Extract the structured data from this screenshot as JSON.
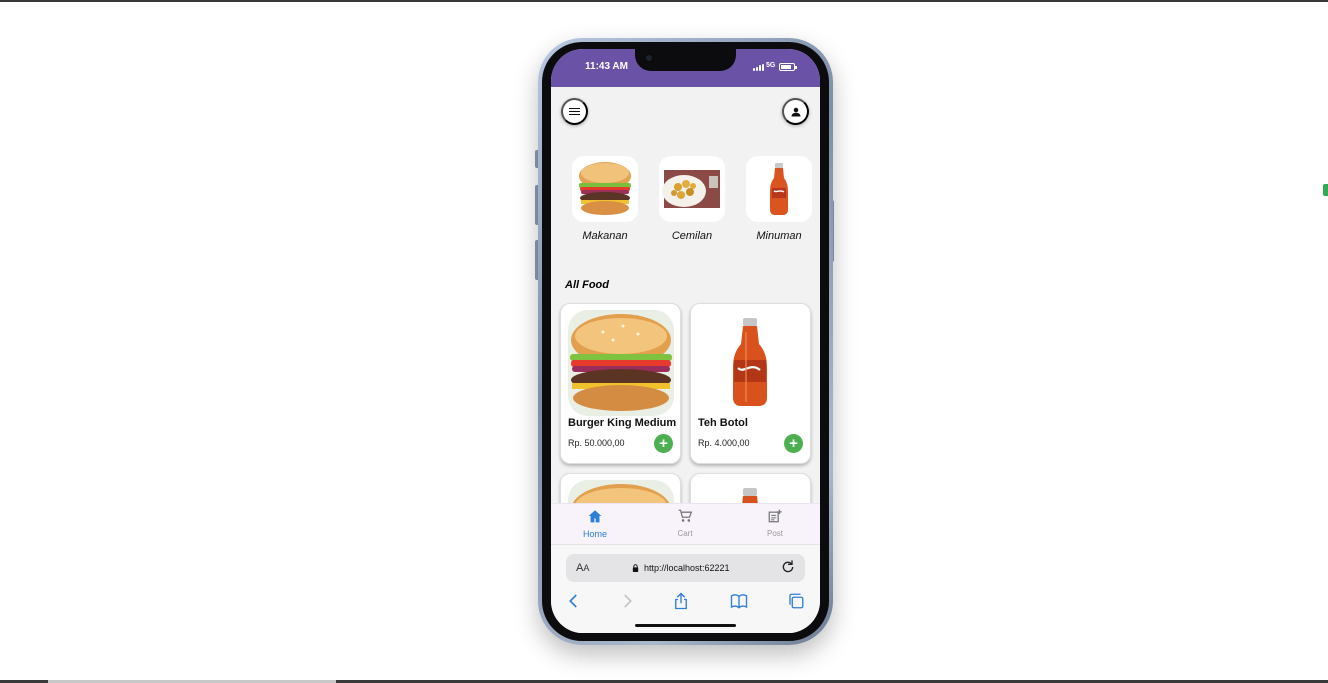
{
  "status_bar": {
    "time": "11:43 AM",
    "network": "5G"
  },
  "categories": [
    {
      "label": "Makanan",
      "icon": "burger-image"
    },
    {
      "label": "Cemilan",
      "icon": "snack-plate-image"
    },
    {
      "label": "Minuman",
      "icon": "bottle-image"
    }
  ],
  "section_title": "All Food",
  "products": [
    {
      "name": "Burger King Medium",
      "price": "Rp. 50.000,00",
      "image": "burger-image"
    },
    {
      "name": "Teh Botol",
      "price": "Rp. 4.000,00",
      "image": "bottle-image"
    }
  ],
  "add_label": "+",
  "bottom_nav": [
    {
      "label": "Home",
      "icon": "home-icon",
      "active": true
    },
    {
      "label": "Cart",
      "icon": "cart-icon",
      "active": false
    },
    {
      "label": "Post",
      "icon": "post-add-icon",
      "active": false
    }
  ],
  "browser": {
    "text_size_big": "A",
    "text_size_small": "A",
    "url": "http://localhost:62221"
  },
  "colors": {
    "status_bar": "#6a52a7",
    "accent_add": "#4caf50",
    "nav_active": "#2d7fd8",
    "safari_blue": "#2f7fd9"
  }
}
